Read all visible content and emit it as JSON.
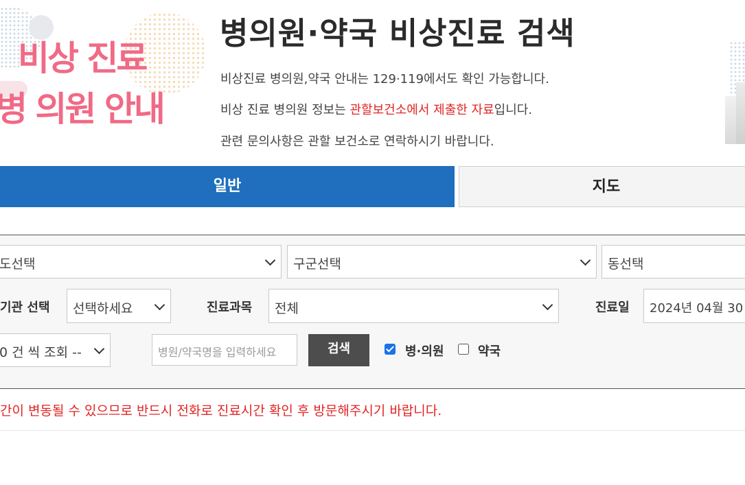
{
  "banner": {
    "promo_line1": "비상 진료",
    "promo_line2": "병 의원 안내",
    "title": "병의원·약국 비상진료 검색",
    "info1": "비상진료 병의원,약국 안내는 129·119에서도 확인 가능합니다.",
    "info2_pre": "비상 진료 병의원 정보는 ",
    "info2_red": "관할보건소에서 제출한 자료",
    "info2_post": "입니다.",
    "info3": "관련 문의사항은 관할 보건소로 연락하시기 바랍니다.",
    "accent_color": "#f06a86"
  },
  "tabs": [
    {
      "label": "일반",
      "active": true,
      "color": "#1f6fbe"
    },
    {
      "label": "지도",
      "active": false
    }
  ],
  "search": {
    "sido_select": "도선택",
    "gugun_select": "구군선택",
    "dong_select": "동선택",
    "org_type_label": "기관 선택",
    "org_type_select": "선택하세요",
    "dept_label": "진료과목",
    "dept_select": "전체",
    "date_label": "진료일",
    "date_value": "2024년 04월 30",
    "page_size_select": "0 건 씩 조회 --",
    "name_placeholder": "병원/약국명을 입력하세요",
    "search_button": "검색",
    "checkbox_hospital": {
      "label": "병·의원",
      "checked": true
    },
    "checkbox_pharmacy": {
      "label": "약국",
      "checked": false
    }
  },
  "notice": "간이 변동될 수 있으므로 반드시 전화로 진료시간 확인 후 방문해주시기 바랍니다.",
  "colors": {
    "notice_red": "#e22424",
    "button_dark": "#4d4d4d",
    "checkbox_blue": "#1a73e8"
  }
}
